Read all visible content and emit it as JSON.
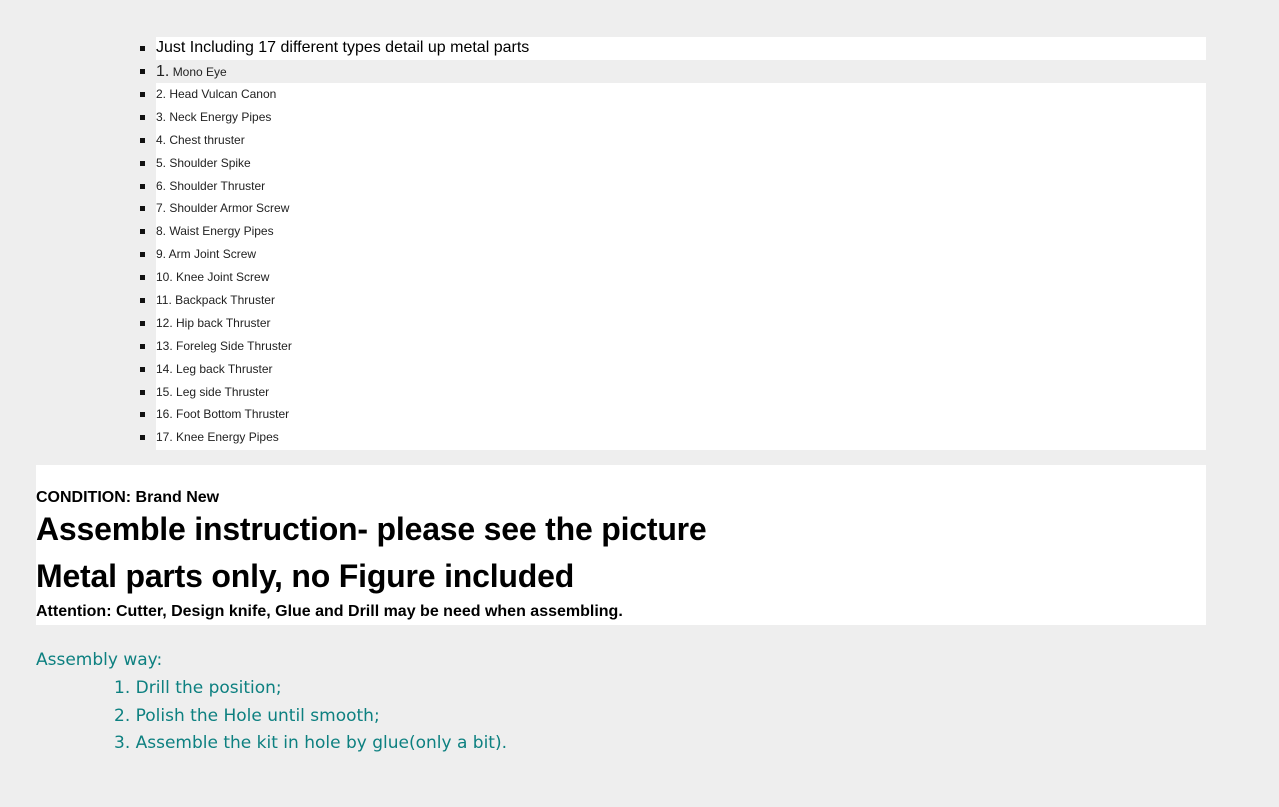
{
  "parts": {
    "intro": "Just Including 17 different types detail up metal parts",
    "first_number": "1.",
    "first_label": "Mono Eye",
    "items": [
      "2.  Head Vulcan Canon",
      "3.  Neck Energy Pipes",
      "4. Chest thruster",
      "5. Shoulder Spike",
      "6. Shoulder Thruster",
      "7. Shoulder Armor Screw",
      "8. Waist Energy Pipes",
      "9. Arm Joint Screw",
      "10. Knee Joint Screw",
      "11. Backpack Thruster",
      "12. Hip back Thruster",
      "13. Foreleg Side Thruster",
      "14. Leg back Thruster",
      "15. Leg side Thruster",
      "16. Foot Bottom Thruster",
      "17. Knee Energy Pipes"
    ]
  },
  "info": {
    "condition": "CONDITION: Brand New",
    "heading_1": "Assemble instruction- please see the picture",
    "heading_2": "Metal parts only, no Figure included",
    "attention": "Attention: Cutter, Design knife, Glue and Drill may be need when assembling."
  },
  "assembly": {
    "title": "Assembly way:",
    "steps": [
      "1. Drill the position;",
      "2. Polish the Hole until smooth;",
      "3. Assemble the kit in hole by glue(only a bit)."
    ]
  },
  "colors": {
    "background": "#eeeeee",
    "panel": "#ffffff",
    "assembly_text": "#0d8080"
  }
}
